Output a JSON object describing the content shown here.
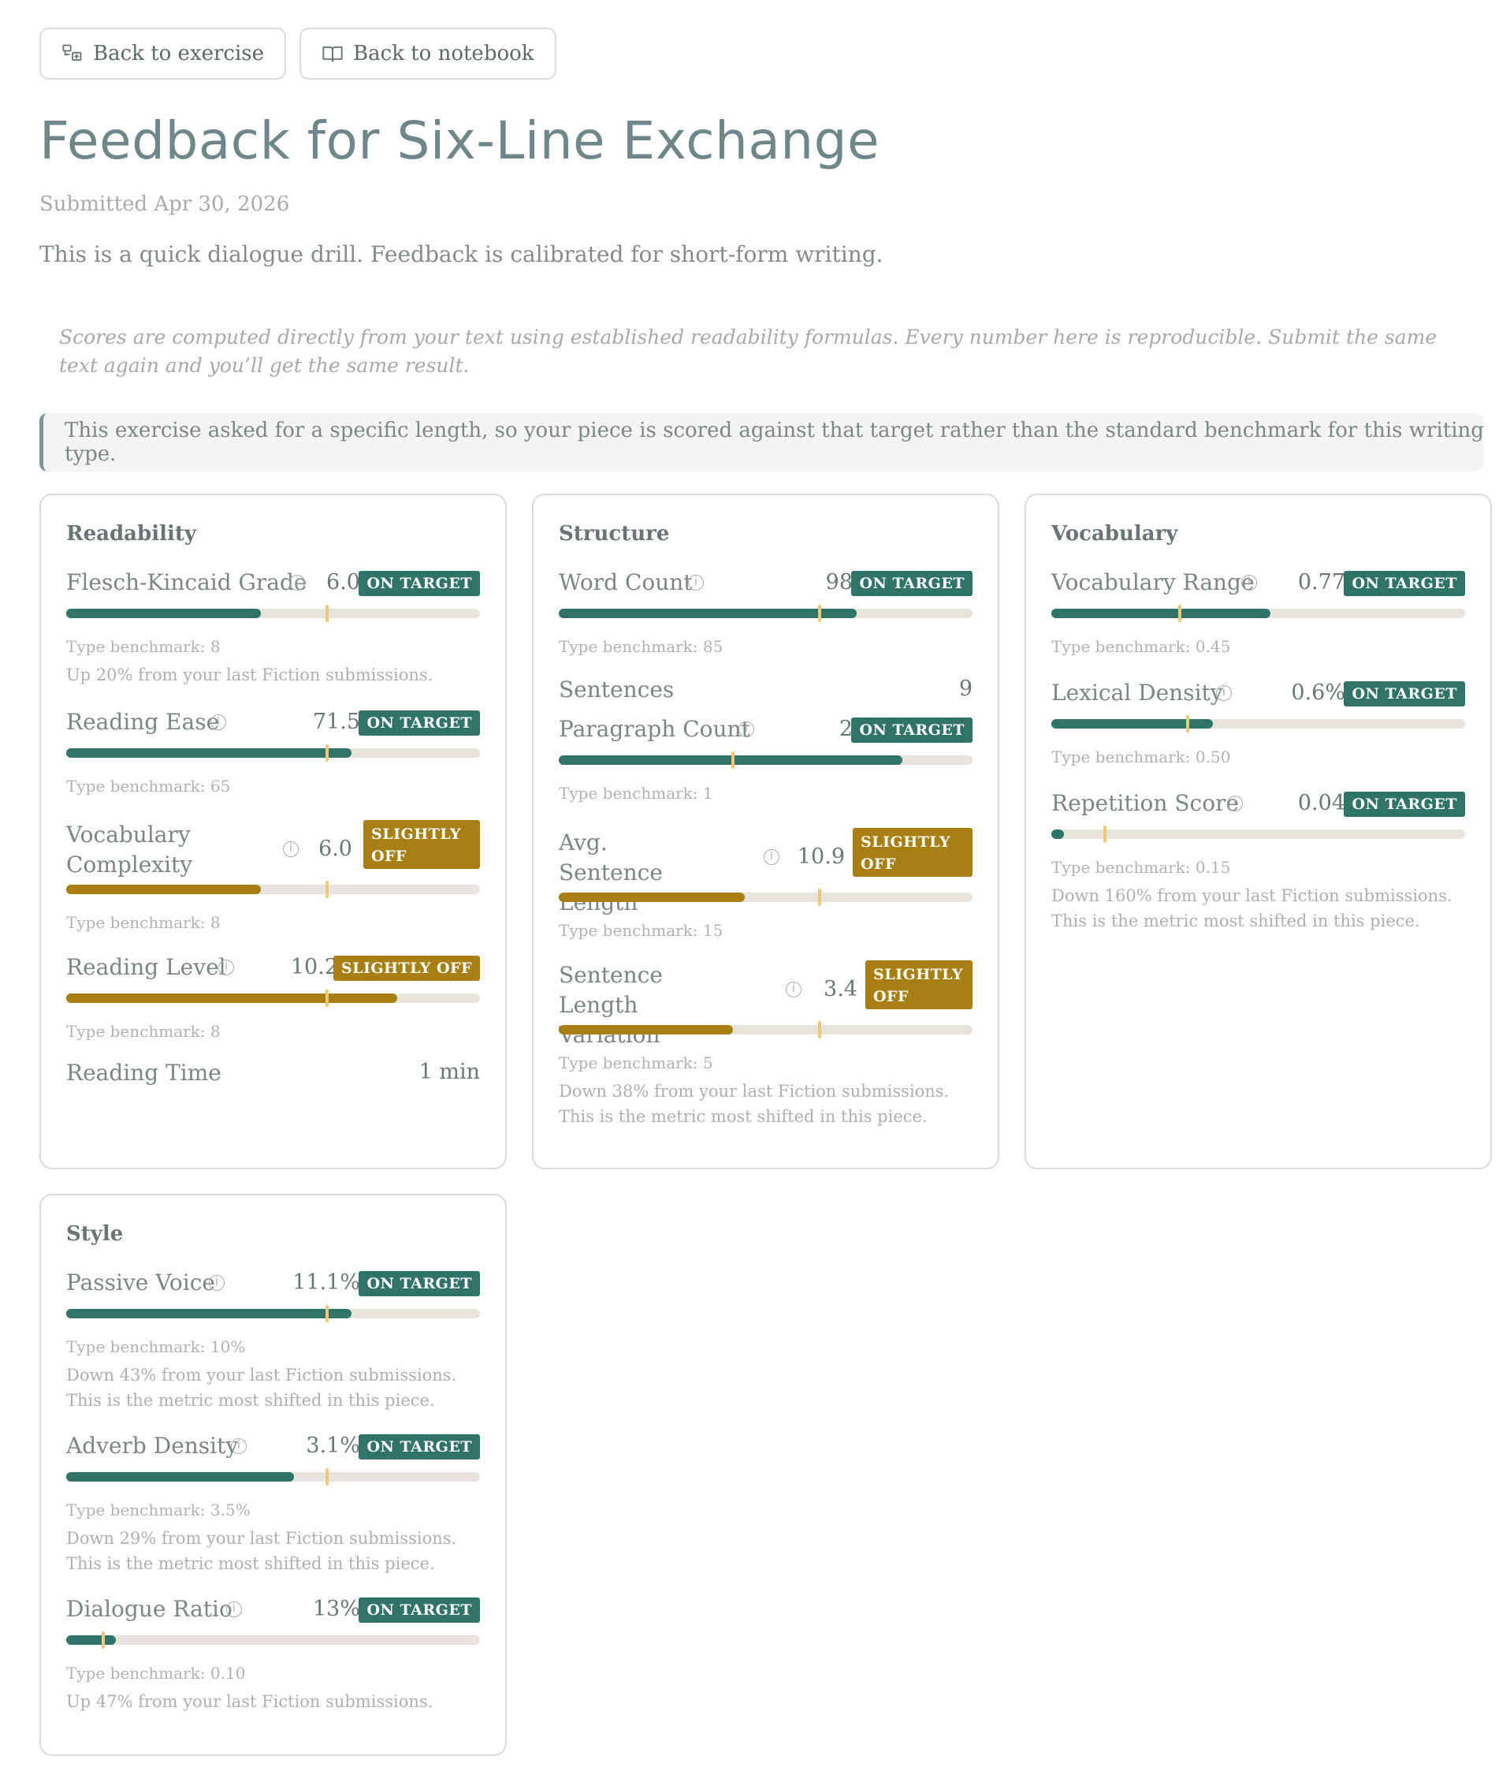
{
  "nav": {
    "back_exercise": "Back to exercise",
    "back_notebook": "Back to notebook"
  },
  "header": {
    "title": "Feedback for Six-Line Exchange",
    "submitted": "Submitted Apr 30, 2026",
    "intro": "This is a quick dialogue drill. Feedback is calibrated for short-form writing.",
    "note": "Scores are computed directly from your text using established readability formulas. Every number here is reproducible. Submit the same text again and you’ll get the same result.",
    "callout": "This exercise asked for a specific length, so your piece is scored against that target rather than the standard benchmark for this writing type."
  },
  "colors": {
    "on_target": "#2f7466",
    "slightly_off": "#a77f12",
    "benchmark_tick": "#edc879",
    "track": "#e6e4dd"
  },
  "cards": {
    "readability": {
      "title": "Readability",
      "fk_grade": {
        "name": "Flesch-Kincaid Grade",
        "value": "6.0",
        "status": "ON TARGET",
        "fill": 0.47,
        "benchmark_pos": 0.63,
        "bench": "Type benchmark: 8",
        "delta": "Up 20% from your last Fiction submissions."
      },
      "reading_ease": {
        "name": "Reading Ease",
        "value": "71.5",
        "status": "ON TARGET",
        "fill": 0.69,
        "benchmark_pos": 0.63,
        "bench": "Type benchmark: 65"
      },
      "vocab_complexity": {
        "name": "Vocabulary Complexity",
        "value": "6.0",
        "status": "SLIGHTLY OFF",
        "fill": 0.47,
        "benchmark_pos": 0.63,
        "bench": "Type benchmark: 8"
      },
      "reading_level": {
        "name": "Reading Level",
        "value": "10.2",
        "status": "SLIGHTLY OFF",
        "fill": 0.8,
        "benchmark_pos": 0.63,
        "bench": "Type benchmark: 8"
      },
      "reading_time": {
        "name": "Reading Time",
        "value": "1 min"
      }
    },
    "structure": {
      "title": "Structure",
      "word_count": {
        "name": "Word Count",
        "value": "98",
        "status": "ON TARGET",
        "fill": 0.72,
        "benchmark_pos": 0.63,
        "bench": "Type benchmark: 85"
      },
      "sentences": {
        "name": "Sentences",
        "value": "9"
      },
      "paragraph_count": {
        "name": "Paragraph Count",
        "value": "2",
        "status": "ON TARGET",
        "fill": 0.83,
        "benchmark_pos": 0.42,
        "bench": "Type benchmark: 1"
      },
      "avg_sentence_length": {
        "name": "Avg. Sentence Length",
        "value": "10.9",
        "status": "SLIGHTLY OFF",
        "fill": 0.45,
        "benchmark_pos": 0.63,
        "bench": "Type benchmark: 15"
      },
      "sentence_variation": {
        "name": "Sentence Length Variation",
        "value": "3.4",
        "status": "SLIGHTLY OFF",
        "fill": 0.42,
        "benchmark_pos": 0.63,
        "bench": "Type benchmark: 5",
        "delta": "Down 38% from your last Fiction submissions. This is the metric most shifted in this piece."
      }
    },
    "vocabulary": {
      "title": "Vocabulary",
      "vocab_range": {
        "name": "Vocabulary Range",
        "value": "0.77",
        "status": "ON TARGET",
        "fill": 0.53,
        "benchmark_pos": 0.31,
        "bench": "Type benchmark: 0.45"
      },
      "lexical_density": {
        "name": "Lexical Density",
        "value": "0.6%",
        "status": "ON TARGET",
        "fill": 0.39,
        "benchmark_pos": 0.33,
        "bench": "Type benchmark: 0.50"
      },
      "repetition": {
        "name": "Repetition Score",
        "value": "0.04",
        "status": "ON TARGET",
        "fill": 0.03,
        "benchmark_pos": 0.13,
        "bench": "Type benchmark: 0.15",
        "delta": "Down 160% from your last Fiction submissions. This is the metric most shifted in this piece."
      }
    },
    "style": {
      "title": "Style",
      "passive_voice": {
        "name": "Passive Voice",
        "value": "11.1%",
        "status": "ON TARGET",
        "fill": 0.69,
        "benchmark_pos": 0.63,
        "bench": "Type benchmark: 10%",
        "delta": "Down 43% from your last Fiction submissions. This is the metric most shifted in this piece."
      },
      "adverb_density": {
        "name": "Adverb Density",
        "value": "3.1%",
        "status": "ON TARGET",
        "fill": 0.55,
        "benchmark_pos": 0.63,
        "bench": "Type benchmark: 3.5%",
        "delta": "Down 29% from your last Fiction submissions. This is the metric most shifted in this piece."
      },
      "dialogue_ratio": {
        "name": "Dialogue Ratio",
        "value": "13%",
        "status": "ON TARGET",
        "fill": 0.12,
        "benchmark_pos": 0.09,
        "bench": "Type benchmark: 0.10",
        "delta": "Up 47% from your last Fiction submissions."
      }
    }
  }
}
